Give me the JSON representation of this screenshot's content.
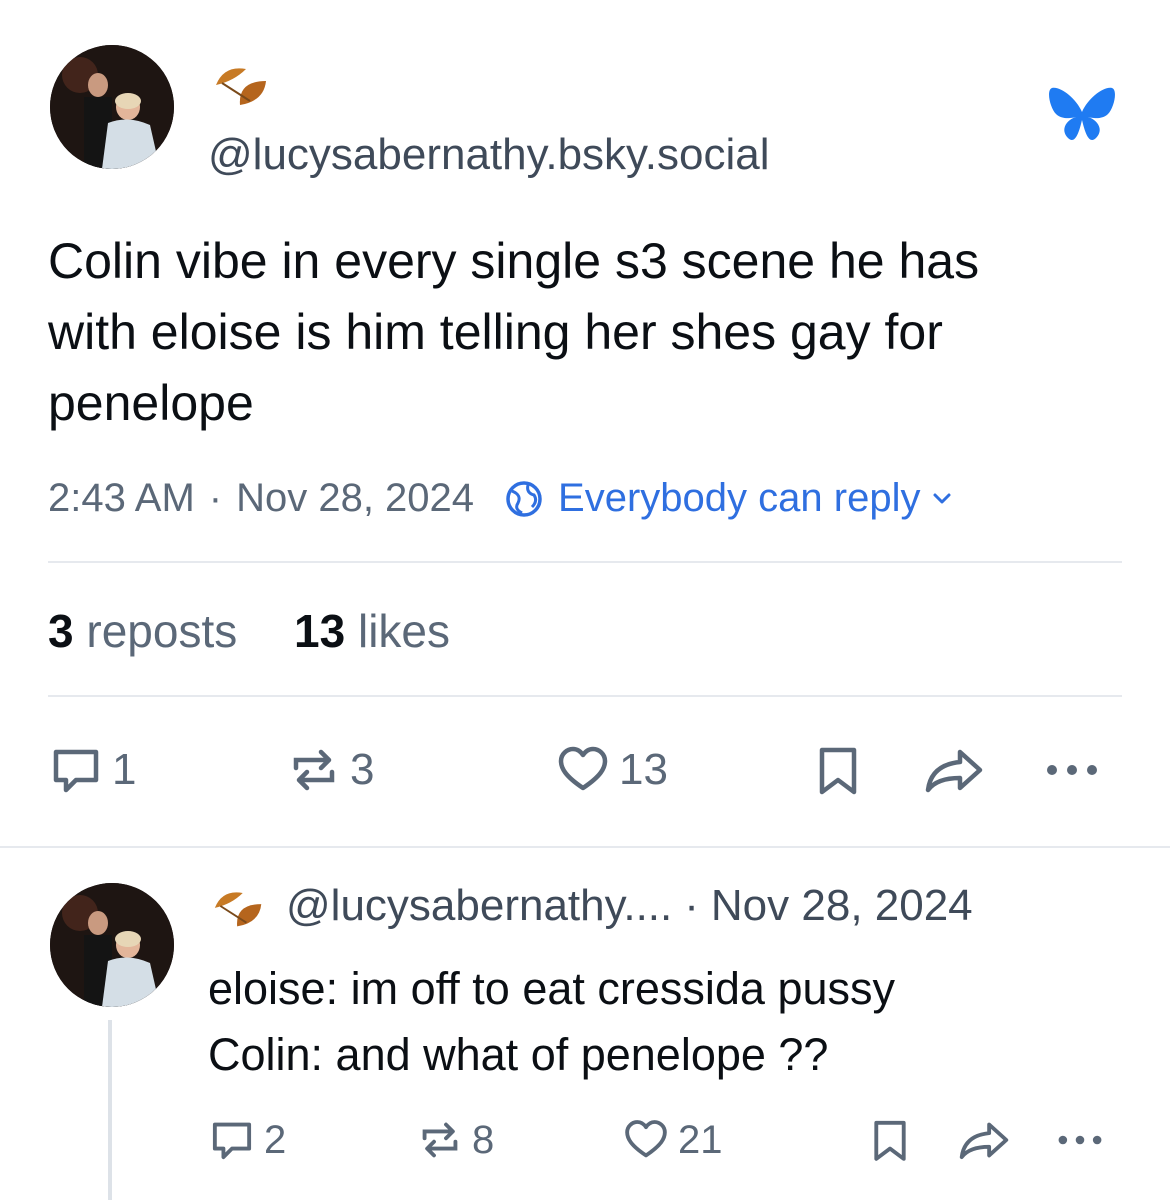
{
  "post": {
    "handle": "@lucysabernathy.bsky.social",
    "text_lines": [
      "Colin vibe in every single s3 scene he has",
      "with eloise is him telling her shes gay for",
      "penelope"
    ],
    "time": "2:43 AM",
    "separator": "·",
    "date": "Nov 28, 2024",
    "reply_setting": "Everybody can reply",
    "reposts_count": "3",
    "reposts_label": "reposts",
    "likes_count": "13",
    "likes_label": "likes",
    "actions": {
      "reply_count": "1",
      "repost_count": "3",
      "like_count": "13"
    }
  },
  "reply": {
    "handle": "@lucysabernathy....",
    "separator": "·",
    "date": "Nov 28, 2024",
    "text_lines": [
      "eloise: im off to eat cressida pussy",
      "Colin: and what of penelope ??"
    ],
    "actions": {
      "reply_count": "2",
      "repost_count": "8",
      "like_count": "21"
    }
  },
  "colors": {
    "accent": "#2f6fe0",
    "muted": "#5b6878",
    "text": "#0b0f14",
    "divider": "#e6e9ee",
    "bluesky": "#1f7bf2"
  },
  "icons": [
    "leaf-emoji-icon",
    "bluesky-butterfly-icon",
    "globe-icon",
    "chevron-down-icon",
    "reply-icon",
    "repost-icon",
    "heart-icon",
    "bookmark-icon",
    "share-icon",
    "more-icon"
  ]
}
